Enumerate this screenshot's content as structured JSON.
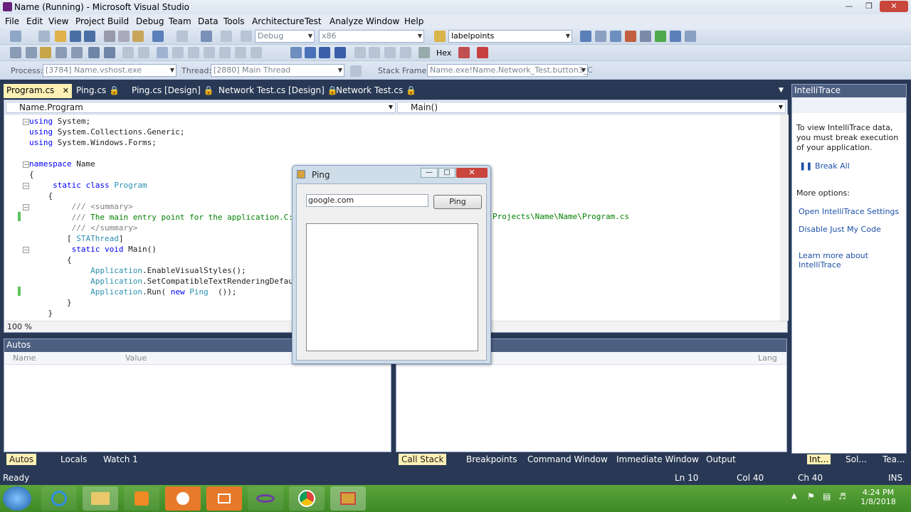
{
  "window": {
    "title": "Name (Running) - Microsoft Visual Studio"
  },
  "menu": [
    "File",
    "Edit",
    "View",
    "Project",
    "Build",
    "Debug",
    "Team",
    "Data",
    "Tools",
    "Architecture",
    "Test",
    "Analyze",
    "Window",
    "Help"
  ],
  "toolbar": {
    "config": "Debug",
    "platform": "x86",
    "find": "labelpoints",
    "hex_label": "Hex"
  },
  "debugbar": {
    "process_label": "Process:",
    "process_value": "[3784] Name.vshost.exe",
    "thread_label": "Thread:",
    "thread_value": "[2880] Main Thread",
    "stack_label": "Stack Frame:",
    "stack_value": "Name.exe!Name.Network_Test.button3_C"
  },
  "tabs": [
    "Program.cs",
    "Ping.cs",
    "Ping.cs [Design]",
    "Network Test.cs [Design]",
    "Network Test.cs"
  ],
  "editor": {
    "nav_left": "Name.Program",
    "nav_right": "Main()",
    "zoom": "100 %",
    "lines": [
      {
        "parts": [
          [
            "kw",
            "using"
          ],
          [
            "",
            "System;"
          ]
        ]
      },
      {
        "parts": [
          [
            "kw",
            "using"
          ],
          [
            "",
            "System.Collections.Generic;"
          ]
        ]
      },
      {
        "parts": [
          [
            "kw",
            "using"
          ],
          [
            "",
            "System.Windows.Forms;"
          ]
        ]
      },
      {
        "parts": []
      },
      {
        "parts": [
          [
            "kw",
            "namespace"
          ],
          [
            "",
            "Name"
          ]
        ]
      },
      {
        "parts": [
          [
            "",
            "{"
          ]
        ]
      },
      {
        "parts": [
          [
            "",
            "    "
          ],
          [
            "kw",
            "static class"
          ],
          [
            "ty",
            "Program"
          ]
        ]
      },
      {
        "parts": [
          [
            "",
            "    {"
          ]
        ]
      },
      {
        "parts": [
          [
            "",
            "        "
          ],
          [
            "gr",
            "///"
          ],
          [
            "gr",
            "<summary>"
          ]
        ]
      },
      {
        "parts": [
          [
            "",
            "        "
          ],
          [
            "gr",
            "///"
          ],
          [
            "cm",
            "The main entry point for the application.C:\\"
          ]
        ]
      },
      {
        "parts": [
          [
            "",
            "        "
          ],
          [
            "gr",
            "///"
          ],
          [
            "gr",
            "</summary>"
          ]
        ]
      },
      {
        "parts": [
          [
            "",
            "        ["
          ],
          [
            "ty",
            "STAThread"
          ],
          [
            "",
            "]"
          ]
        ]
      },
      {
        "parts": [
          [
            "",
            "        "
          ],
          [
            "kw",
            "static void"
          ],
          [
            "",
            "Main()"
          ]
        ]
      },
      {
        "parts": [
          [
            "",
            "        {"
          ]
        ]
      },
      {
        "parts": [
          [
            "",
            "            "
          ],
          [
            "ty",
            "Application"
          ],
          [
            "",
            ".EnableVisualStyles();"
          ]
        ]
      },
      {
        "parts": [
          [
            "",
            "            "
          ],
          [
            "ty",
            "Application"
          ],
          [
            "",
            ".SetCompatibleTextRenderingDefaul"
          ]
        ]
      },
      {
        "parts": [
          [
            "",
            "            "
          ],
          [
            "ty",
            "Application"
          ],
          [
            "",
            ".Run("
          ],
          [
            "kw",
            "new"
          ],
          [
            "ty",
            "Ping"
          ],
          [
            "",
            "  ());"
          ]
        ]
      },
      {
        "parts": [
          [
            "",
            "        }"
          ]
        ]
      },
      {
        "parts": [
          [
            "",
            "    }"
          ]
        ]
      }
    ],
    "overflow_text": "Projects\\Name\\Name\\Program.cs"
  },
  "intellitrace": {
    "title": "IntelliTrace",
    "message": "To view IntelliTrace data, you must break execution of your application.",
    "break_all": "Break All",
    "more_options": "More options:",
    "links": [
      "Open IntelliTrace Settings",
      "Disable Just My Code",
      "Learn more about IntelliTrace"
    ]
  },
  "autos": {
    "title": "Autos",
    "columns": [
      "Name",
      "Value"
    ],
    "right_column": "Lang",
    "tabs": [
      "Autos",
      "Locals",
      "Watch 1"
    ]
  },
  "bottom_tabs": [
    "Call Stack",
    "Breakpoints",
    "Command Window",
    "Immediate Window",
    "Output"
  ],
  "side_tabs": [
    "Int...",
    "Sol...",
    "Tea..."
  ],
  "ping_form": {
    "title": "Ping",
    "host": "google.com",
    "button": "Ping"
  },
  "status": {
    "ready": "Ready",
    "ln": "Ln 10",
    "col": "Col 40",
    "ch": "Ch 40",
    "ins": "INS"
  },
  "clock": {
    "time": "4:24 PM",
    "date": "1/8/2018"
  },
  "colors": {
    "accent": "#293955",
    "tab_active": "#fff1b5",
    "link": "#1e4fa8"
  }
}
